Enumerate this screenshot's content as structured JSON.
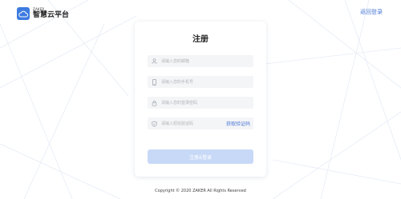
{
  "header": {
    "brand": "ZAKER",
    "app_name": "智慧云平台",
    "back_link": "返回登录"
  },
  "form": {
    "title": "注册",
    "fields": {
      "email_placeholder": "请输入您的邮箱",
      "phone_placeholder": "请输入您的手机号",
      "password_placeholder": "请输入您的登录密码",
      "code_placeholder": "请输入短信验证码"
    },
    "get_code_label": "获取验证码",
    "submit_label": "注册&登录"
  },
  "footer": {
    "copyright": "Copyright © 2020 ZAKER All Rights Reserved"
  },
  "colors": {
    "accent": "#4a78d6",
    "logo": "#3d7bdf",
    "submit_disabled": "#c8d9f7",
    "field_bg": "#f4f5f7"
  }
}
